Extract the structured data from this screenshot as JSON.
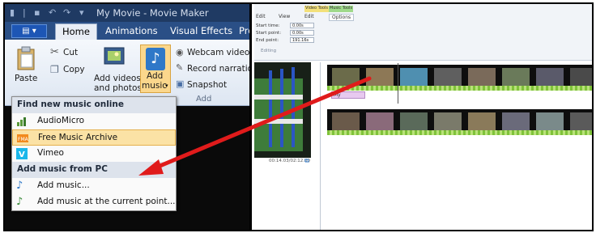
{
  "window": {
    "title": "My Movie - Movie Maker",
    "file_menu_glyph": "▤ ▾"
  },
  "tabs": [
    "Home",
    "Animations",
    "Visual Effects",
    "Proj"
  ],
  "ribbon": {
    "paste": "Paste",
    "cut": "Cut",
    "copy": "Copy",
    "add_videos_line1": "Add videos",
    "add_videos_line2": "and photos",
    "add_music_line1": "Add",
    "add_music_line2": "music",
    "webcam": "Webcam video",
    "record_narration": "Record narration",
    "snapshot": "Snapshot",
    "group_add": "Add"
  },
  "music_menu": {
    "header_online": "Find new music online",
    "items_online": [
      {
        "label": "AudioMicro",
        "icon": "audiomicro-icon"
      },
      {
        "label": "Free Music Archive",
        "icon": "fma-icon",
        "highlighted": true
      },
      {
        "label": "Vimeo",
        "icon": "vimeo-icon"
      }
    ],
    "header_pc": "Add music from PC",
    "items_pc": [
      {
        "label": "Add music...",
        "icon": "music-note-icon"
      },
      {
        "label": "Add music at the current point...",
        "icon": "music-note-point-icon"
      }
    ]
  },
  "timeline_view": {
    "context_tabs": [
      "Video Tools",
      "Music Tools"
    ],
    "tabs": [
      "Edit",
      "View",
      "Edit",
      "Options"
    ],
    "fields": [
      {
        "label": "Start time:",
        "value": "0.00s"
      },
      {
        "label": "Start point:",
        "value": "0.00s"
      },
      {
        "label": "End point:",
        "value": "191.16s"
      }
    ],
    "group": "Editing",
    "timecode": "00:14.03/02:12.00",
    "music_clip": "My"
  },
  "colors": {
    "accent_orange": "#fbd78c",
    "highlight": "#fbe2a5",
    "arrow_red": "#e01b1b",
    "title_blue": "#1f3a63"
  }
}
